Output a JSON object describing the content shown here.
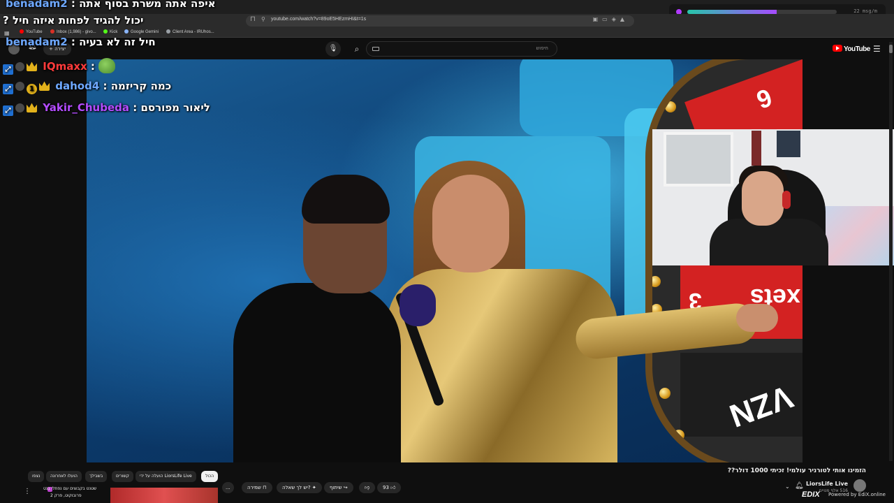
{
  "browser": {
    "url": "youtube.com/watch?v=89oE5HEzmHI&t=1s",
    "bookmarks": [
      {
        "label": "YouTube",
        "color": "#ff0000"
      },
      {
        "label": "Inbox (1,986) - givo...",
        "color": "#d93025"
      },
      {
        "label": "Kick",
        "color": "#53fc18"
      },
      {
        "label": "Google Gemini",
        "color": "#8ab4f8"
      },
      {
        "label": "Client Area - IRUhos...",
        "color": "#9aa0a6"
      }
    ],
    "stats": {
      "text": "22 msg/m",
      "level": 0.6
    }
  },
  "youtube": {
    "search_placeholder": "חיפוש",
    "create_label": "יצירה",
    "logo_text": "YouTube"
  },
  "chat": [
    {
      "user": "benadam2",
      "user_color": "#6ea8ff",
      "message": "איפה אתה משרת בסוף אתה",
      "badges": []
    },
    {
      "user": "",
      "user_color": "#ffffff",
      "message": "? יכול להגיד לפחות איזה חיל",
      "badges": []
    },
    {
      "user": "benadam2",
      "user_color": "#6ea8ff",
      "message": "חיל זה לא בעיה",
      "badges": []
    },
    {
      "user": "IQmaxx",
      "user_color": "#ff3b3b",
      "message": "",
      "emote": "pepe",
      "badges": [
        "arrow",
        "face",
        "crown"
      ]
    },
    {
      "user": "dahod4",
      "user_color": "#6ea8ff",
      "message": "כמה קריזמה",
      "badges": [
        "arrow",
        "face",
        "num",
        "crown"
      ],
      "badge_num": "1"
    },
    {
      "user": "Yakir_Chubeda",
      "user_color": "#b44cff",
      "message": "ליאור מפורסם",
      "badges": [
        "arrow",
        "face",
        "crown"
      ]
    }
  ],
  "video": {
    "title": "הזמינו אותי לטורניר עולמי! זכיתי 1000 דולר??",
    "wheel_numbers": [
      "6",
      "3"
    ],
    "wheel_text": [
      "xets",
      "VZN"
    ]
  },
  "channel": {
    "name": "LiorsLife Live",
    "subs": "516 אלף מנויים"
  },
  "actions": {
    "likes": "93",
    "share_label": "שיתוף",
    "ask_label": "יש לך שאלה?",
    "save_label": "שמירה",
    "more_label": "..."
  },
  "chips": [
    {
      "label": "הכול",
      "active": true
    },
    {
      "label": "הועלה על ידי LiorsLife Live",
      "active": false
    },
    {
      "label": "קשורים",
      "active": false
    },
    {
      "label": "בשבילך",
      "active": false
    },
    {
      "label": "הועלו לאחרונה",
      "active": false
    },
    {
      "label": "נצפו",
      "active": false
    }
  ],
  "recommended": {
    "line1": "שטנט בקבוצים עם נפתלי בנט",
    "line2": "פרובוקוט, פרק 2"
  },
  "overlay": {
    "edix_logo": "EDIX",
    "edix_text": "Powered by EdiX.online"
  }
}
